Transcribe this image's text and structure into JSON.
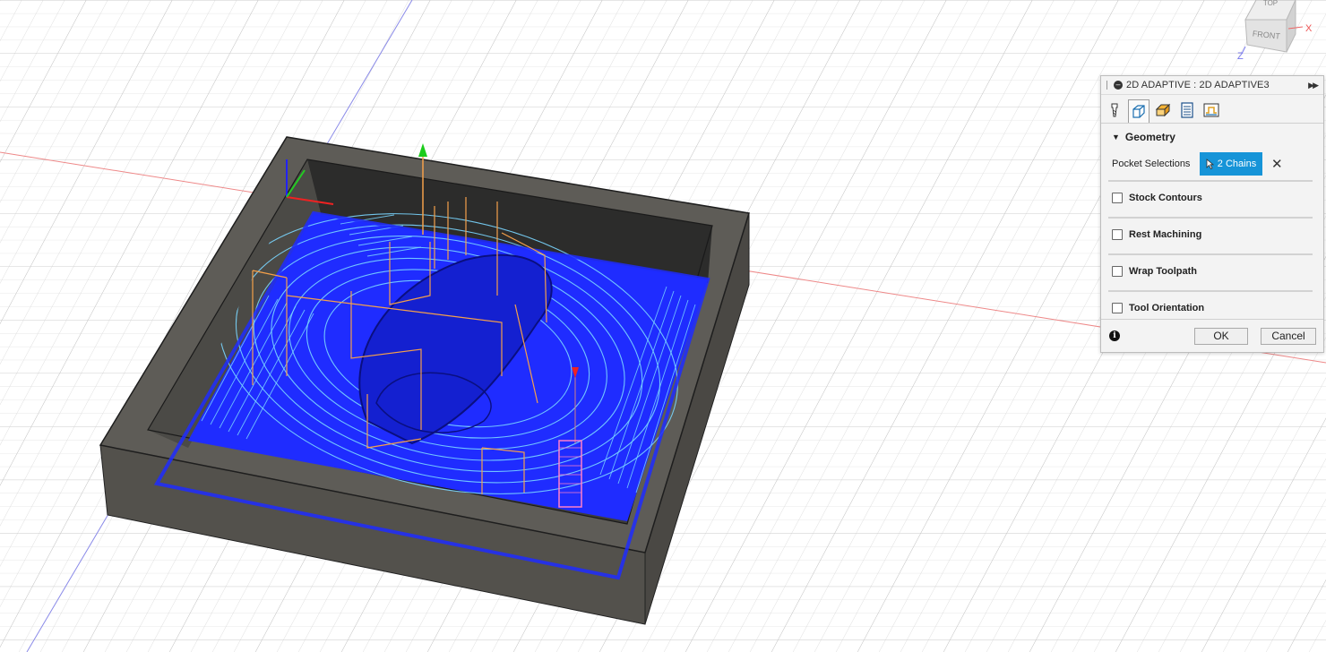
{
  "viewcube": {
    "top_label": "TOP",
    "front_label": "FRONT",
    "x_label": "X",
    "z_label": "Z"
  },
  "dialog": {
    "title": "2D ADAPTIVE : 2D ADAPTIVE3",
    "tabs": [
      {
        "name": "tool-icon"
      },
      {
        "name": "geometry-icon"
      },
      {
        "name": "heights-icon"
      },
      {
        "name": "passes-icon"
      },
      {
        "name": "linking-icon"
      }
    ],
    "geometry_heading": "Geometry",
    "pocket_label": "Pocket Selections",
    "chain_button": "2 Chains",
    "options": [
      {
        "label": "Stock Contours",
        "checked": false
      },
      {
        "label": "Rest Machining",
        "checked": false
      },
      {
        "label": "Wrap Toolpath",
        "checked": false
      },
      {
        "label": "Tool Orientation",
        "checked": false
      }
    ],
    "ok_label": "OK",
    "cancel_label": "Cancel",
    "accent": "#1694d8"
  },
  "scene": {
    "stock_color": "#6b6963",
    "toolpath_color": "#1a1aff",
    "linking_color": "#f5a04a"
  }
}
